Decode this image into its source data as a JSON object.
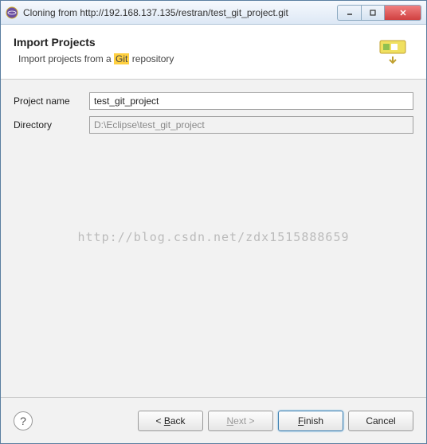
{
  "window": {
    "title": "Cloning from http://192.168.137.135/restran/test_git_project.git"
  },
  "header": {
    "title": "Import Projects",
    "subtitle_pre": "Import projects from a ",
    "subtitle_highlight": "Git",
    "subtitle_post": " repository"
  },
  "form": {
    "project_name_label": "Project name",
    "project_name_value": "test_git_project",
    "directory_label": "Directory",
    "directory_value": "D:\\Eclipse\\test_git_project"
  },
  "watermark": "http://blog.csdn.net/zdx1515888659",
  "buttons": {
    "back": "< Back",
    "next": "Next >",
    "finish": "Finish",
    "cancel": "Cancel"
  }
}
